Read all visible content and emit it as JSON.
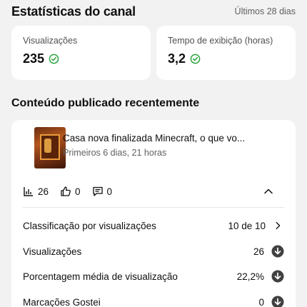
{
  "header": {
    "title": "Estatísticas do canal",
    "period": "Últimos 28 dias"
  },
  "stats": [
    {
      "label": "Visualizações",
      "value": "235"
    },
    {
      "label": "Tempo de exibição (horas)",
      "value": "3,2"
    }
  ],
  "recent": {
    "section_title": "Conteúdo publicado recentemente",
    "video": {
      "title": "Casa nova finalizada Minecraft, o que vo...",
      "meta": "Primeiros 6 dias, 21 horas"
    },
    "metrics": {
      "views": "26",
      "likes": "0",
      "comments": "0"
    },
    "rows": [
      {
        "label": "Classificação por visualizações",
        "value": "10 de 10"
      },
      {
        "label": "Visualizações",
        "value": "26"
      },
      {
        "label": "Porcentagem média de visualização",
        "value": "22,2%"
      },
      {
        "label": "Marcações Gostei",
        "value": "0"
      }
    ]
  },
  "colors": {
    "success": "#2ba640",
    "text": "#0f0f0f",
    "muted": "#606060",
    "icon_dark": "#404040"
  }
}
